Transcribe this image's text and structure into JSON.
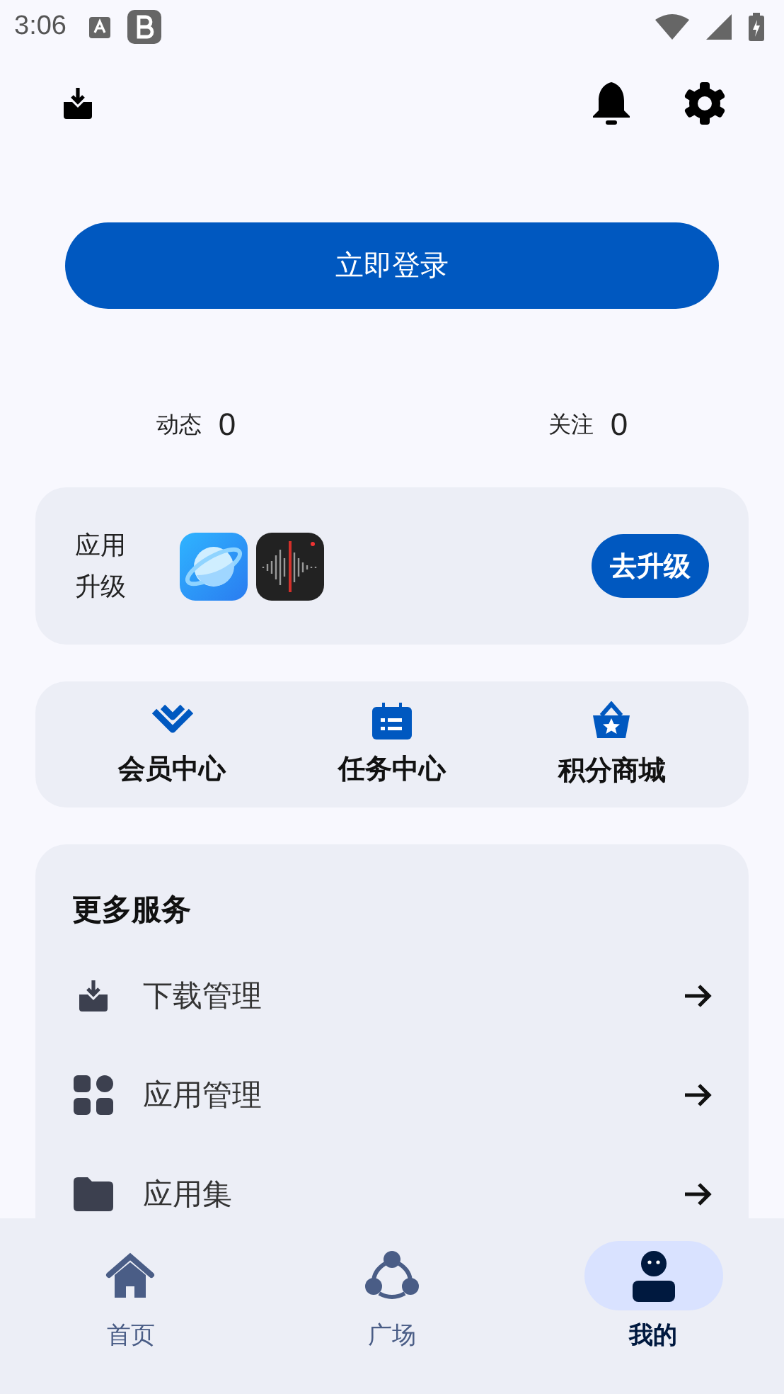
{
  "status_bar": {
    "time": "3:06"
  },
  "login_button": "立即登录",
  "stats": [
    {
      "label": "动态",
      "value": "0"
    },
    {
      "label": "关注",
      "value": "0"
    }
  ],
  "upgrade_card": {
    "label": "应用升级",
    "button": "去升级",
    "apps": [
      {
        "kind": "browser"
      },
      {
        "kind": "recorder"
      }
    ]
  },
  "shortcuts": [
    {
      "kind": "vip",
      "label": "会员中心"
    },
    {
      "kind": "task",
      "label": "任务中心"
    },
    {
      "kind": "shop",
      "label": "积分商城"
    }
  ],
  "more_services": {
    "title": "更多服务",
    "items": [
      {
        "kind": "download",
        "label": "下载管理"
      },
      {
        "kind": "apps",
        "label": "应用管理"
      },
      {
        "kind": "folder",
        "label": "应用集"
      }
    ]
  },
  "bottom_nav": [
    {
      "kind": "home",
      "label": "首页",
      "selected": false
    },
    {
      "kind": "square",
      "label": "广场",
      "selected": false
    },
    {
      "kind": "me",
      "label": "我的",
      "selected": true
    }
  ]
}
